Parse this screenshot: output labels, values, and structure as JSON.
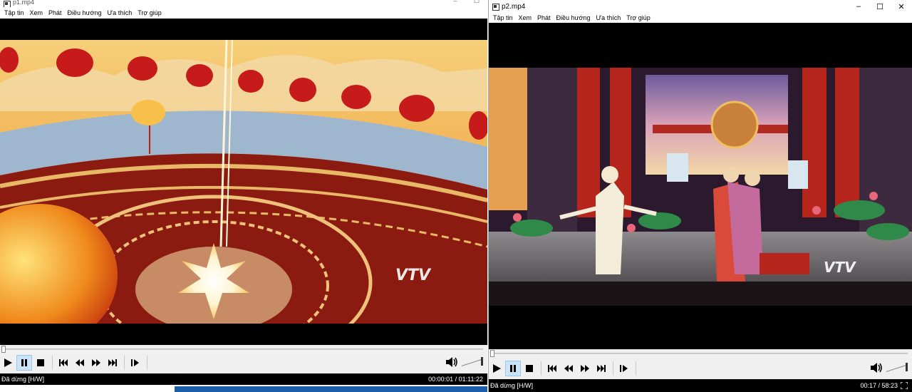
{
  "left_window": {
    "title": "p1.mp4",
    "min_glyph": "–",
    "max_glyph": "☐",
    "menu": [
      "Tập tin",
      "Xem",
      "Phát",
      "Điều hướng",
      "Ưa thích",
      "Trợ giúp"
    ],
    "status_left": "Đã dừng [H/W]",
    "time": "00:00:01 / 01:11:22",
    "watermark": "VTV",
    "progress": 0.0002
  },
  "right_window": {
    "title": "p2.mp4",
    "min_glyph": "–",
    "max_glyph": "☐",
    "close_glyph": "✕",
    "menu": [
      "Tập tin",
      "Xem",
      "Phát",
      "Điều hướng",
      "Ưa thích",
      "Trợ giúp"
    ],
    "status_left": "Đã dừng [H/W]",
    "time": "00:17 / 58:23",
    "watermark": "VTV",
    "progress": 0.005
  },
  "icons": {
    "play": "play-icon",
    "pause": "pause-icon",
    "stop": "stop-icon",
    "prev": "skip-previous-icon",
    "rewind": "rewind-icon",
    "forward": "fast-forward-icon",
    "next": "skip-next-icon",
    "frame_step": "frame-step-icon",
    "volume": "speaker-icon",
    "fullscreen": "fullscreen-icon"
  },
  "colors": {
    "active_button": "#cce4f7",
    "video_bg": "#000000",
    "taskbar_accent": "#1c5ea8"
  }
}
